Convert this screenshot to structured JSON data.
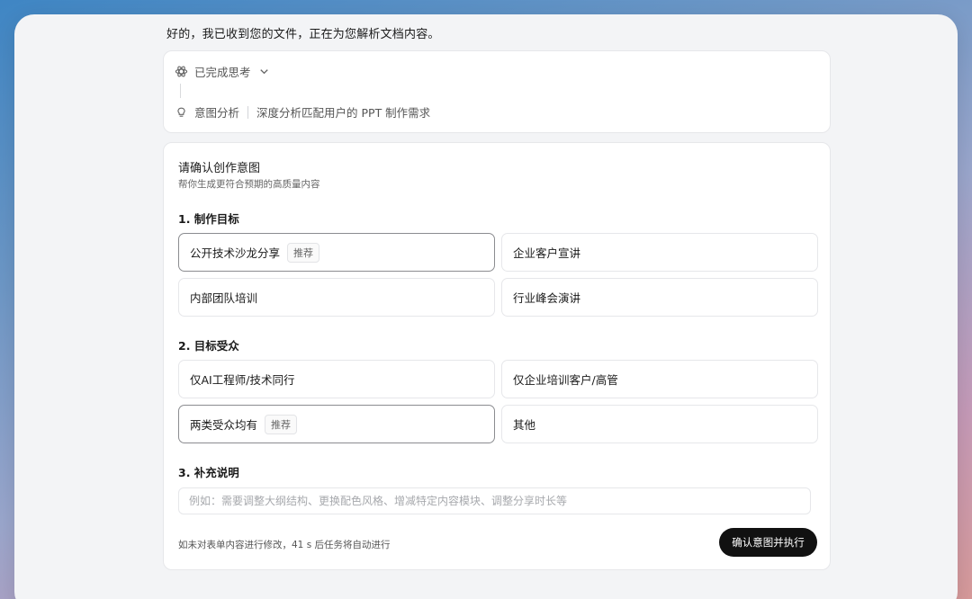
{
  "intro_text": "好的，我已收到您的文件，正在为您解析文档内容。",
  "thinking": {
    "status_label": "已完成思考",
    "step_name": "意图分析",
    "step_desc": "深度分析匹配用户的 PPT 制作需求",
    "icons": {
      "status": "brain-icon",
      "toggle": "chevron-down-icon",
      "step": "lightbulb-icon"
    }
  },
  "form": {
    "title": "请确认创作意图",
    "subtitle": "帮你生成更符合预期的高质量内容",
    "sections": [
      {
        "title": "1. 制作目标",
        "options": [
          {
            "label": "公开技术沙龙分享",
            "tag": "推荐",
            "selected": true
          },
          {
            "label": "企业客户宣讲",
            "selected": false
          },
          {
            "label": "内部团队培训",
            "selected": false
          },
          {
            "label": "行业峰会演讲",
            "selected": false
          }
        ]
      },
      {
        "title": "2. 目标受众",
        "options": [
          {
            "label": "仅AI工程师/技术同行",
            "selected": false
          },
          {
            "label": "仅企业培训客户/高管",
            "selected": false
          },
          {
            "label": "两类受众均有",
            "tag": "推荐",
            "selected": true
          },
          {
            "label": "其他",
            "selected": false
          }
        ]
      },
      {
        "title": "3. 补充说明",
        "placeholder": "例如：需要调整大纲结构、更换配色风格、增减特定内容模块、调整分享时长等",
        "value": ""
      }
    ],
    "footer_note": "如未对表单内容进行修改，41 s 后任务将自动进行",
    "confirm_label": "确认意图并执行"
  }
}
